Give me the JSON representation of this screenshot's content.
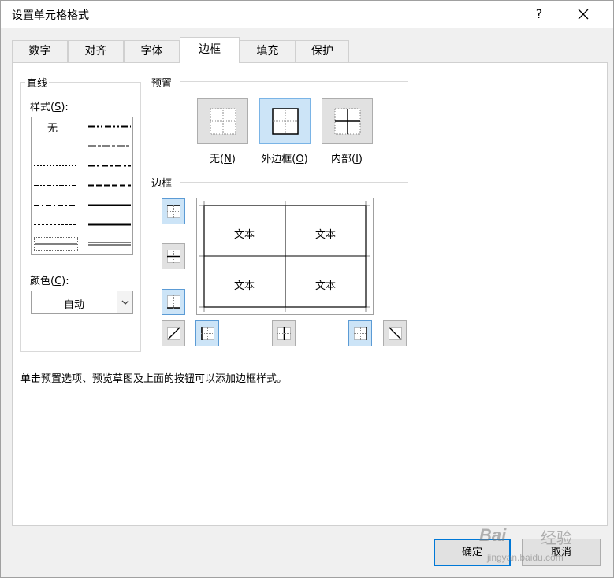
{
  "window": {
    "title": "设置单元格格式",
    "help_label": "?"
  },
  "tabs": [
    {
      "label": "数字",
      "active": false
    },
    {
      "label": "对齐",
      "active": false
    },
    {
      "label": "字体",
      "active": false
    },
    {
      "label": "边框",
      "active": true
    },
    {
      "label": "填充",
      "active": false
    },
    {
      "label": "保护",
      "active": false
    }
  ],
  "line": {
    "group_label": "直线",
    "style_label_pre": "样式(",
    "style_label_key": "S",
    "style_label_post": "):",
    "none_label": "无",
    "color_label_pre": "颜色(",
    "color_label_key": "C",
    "color_label_post": "):",
    "color_value": "自动"
  },
  "presets": {
    "group_label": "预置",
    "items": [
      {
        "label_pre": "无(",
        "key": "N",
        "label_post": ")",
        "selected": false
      },
      {
        "label_pre": "外边框(",
        "key": "O",
        "label_post": ")",
        "selected": true
      },
      {
        "label_pre": "内部(",
        "key": "I",
        "label_post": ")",
        "selected": false
      }
    ]
  },
  "border": {
    "group_label": "边框",
    "preview_cells": [
      "文本",
      "文本",
      "文本",
      "文本"
    ]
  },
  "hint": "单击预置选项、预览草图及上面的按钮可以添加边框样式。",
  "buttons": {
    "ok": "确定",
    "cancel": "取消"
  },
  "watermark": {
    "logo": "Bai",
    "cn": "经验",
    "url": "jingyan.baidu.com"
  },
  "colors": {
    "selected_fill": "#cce4f7",
    "selected_border": "#5b9bd5",
    "default_button_border": "#0078d7"
  }
}
